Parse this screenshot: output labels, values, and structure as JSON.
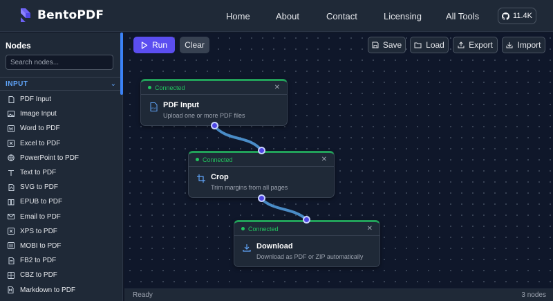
{
  "header": {
    "brand": "BentoPDF",
    "nav": [
      "Home",
      "About",
      "Contact",
      "Licensing",
      "All Tools"
    ],
    "github_stars": "11.4K"
  },
  "sidebar": {
    "title": "Nodes",
    "search_placeholder": "Search nodes...",
    "category": "INPUT",
    "items": [
      {
        "label": "PDF Input",
        "icon": "file-pdf-icon"
      },
      {
        "label": "Image Input",
        "icon": "image-icon"
      },
      {
        "label": "Word to PDF",
        "icon": "word-doc-icon"
      },
      {
        "label": "Excel to PDF",
        "icon": "spreadsheet-icon"
      },
      {
        "label": "PowerPoint to PDF",
        "icon": "globe-icon"
      },
      {
        "label": "Text to PDF",
        "icon": "text-icon"
      },
      {
        "label": "SVG to PDF",
        "icon": "svg-file-icon"
      },
      {
        "label": "EPUB to PDF",
        "icon": "book-icon"
      },
      {
        "label": "Email to PDF",
        "icon": "email-icon"
      },
      {
        "label": "XPS to PDF",
        "icon": "xps-file-icon"
      },
      {
        "label": "MOBI to PDF",
        "icon": "ebook-icon"
      },
      {
        "label": "FB2 to PDF",
        "icon": "fb2-file-icon"
      },
      {
        "label": "CBZ to PDF",
        "icon": "comic-archive-icon"
      },
      {
        "label": "Markdown to PDF",
        "icon": "markdown-icon"
      }
    ]
  },
  "toolbar": {
    "run": "Run",
    "clear": "Clear",
    "save": "Save",
    "load": "Load",
    "export": "Export",
    "import": "Import"
  },
  "nodes": [
    {
      "status": "Connected",
      "title": "PDF Input",
      "description": "Upload one or more PDF files",
      "icon": "pdf-file-icon"
    },
    {
      "status": "Connected",
      "title": "Crop",
      "description": "Trim margins from all pages",
      "icon": "crop-icon"
    },
    {
      "status": "Connected",
      "title": "Download",
      "description": "Download as PDF or ZIP automatically",
      "icon": "download-icon"
    }
  ],
  "statusbar": {
    "state": "Ready",
    "count": "3 nodes"
  },
  "colors": {
    "accent": "#5b4ef0",
    "connected": "#22c55e",
    "link": "#4a8cc7",
    "category": "#60a5fa"
  }
}
